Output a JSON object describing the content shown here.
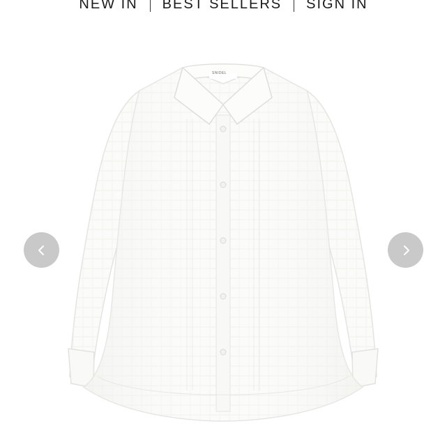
{
  "nav": {
    "items": [
      {
        "label": "NEW IN"
      },
      {
        "label": "BEST SELLERS"
      },
      {
        "label": "SIGN IN"
      }
    ]
  },
  "product": {
    "brand_tag": "SNIDEL",
    "icon": "shirt-image"
  },
  "carousel": {
    "prev_icon": "chevron-left-icon",
    "next_icon": "chevron-right-icon",
    "button_color": "#c9c9c9"
  }
}
